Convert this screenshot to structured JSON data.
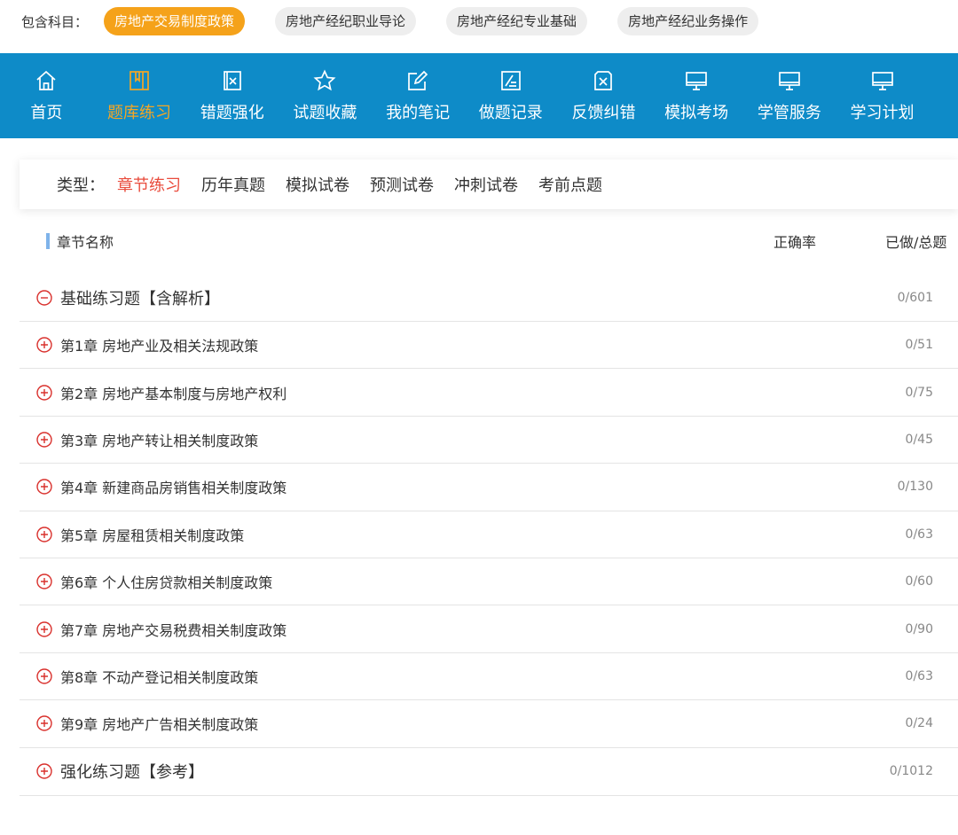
{
  "subjects": {
    "label": "包含科目：",
    "items": [
      {
        "label": "房地产交易制度政策",
        "active": true
      },
      {
        "label": "房地产经纪职业导论",
        "active": false
      },
      {
        "label": "房地产经纪专业基础",
        "active": false
      },
      {
        "label": "房地产经纪业务操作",
        "active": false
      }
    ]
  },
  "nav": {
    "items": [
      {
        "label": "首页",
        "icon": "home-icon"
      },
      {
        "label": "题库练习",
        "icon": "book-icon",
        "active": true
      },
      {
        "label": "错题强化",
        "icon": "wrong-doc-icon"
      },
      {
        "label": "试题收藏",
        "icon": "star-icon"
      },
      {
        "label": "我的笔记",
        "icon": "edit-icon"
      },
      {
        "label": "做题记录",
        "icon": "record-icon"
      },
      {
        "label": "反馈纠错",
        "icon": "feedback-icon"
      },
      {
        "label": "模拟考场",
        "icon": "monitor-icon"
      },
      {
        "label": "学管服务",
        "icon": "monitor-icon"
      },
      {
        "label": "学习计划",
        "icon": "monitor-icon"
      }
    ],
    "active_color": "#f5a623",
    "background": "#0e8bc8"
  },
  "types": {
    "label": "类型：",
    "items": [
      {
        "label": "章节练习",
        "active": true
      },
      {
        "label": "历年真题"
      },
      {
        "label": "模拟试卷"
      },
      {
        "label": "预测试卷"
      },
      {
        "label": "冲刺试卷"
      },
      {
        "label": "考前点题"
      }
    ]
  },
  "table": {
    "headers": {
      "name": "章节名称",
      "accuracy": "正确率",
      "done_total": "已做/总题"
    },
    "rows": [
      {
        "title": "基础练习题【含解析】",
        "count": "0/601",
        "expanded": true,
        "group": true
      },
      {
        "title": "第1章 房地产业及相关法规政策",
        "count": "0/51"
      },
      {
        "title": "第2章 房地产基本制度与房地产权利",
        "count": "0/75"
      },
      {
        "title": "第3章 房地产转让相关制度政策",
        "count": "0/45"
      },
      {
        "title": "第4章 新建商品房销售相关制度政策",
        "count": "0/130"
      },
      {
        "title": "第5章 房屋租赁相关制度政策",
        "count": "0/63"
      },
      {
        "title": "第6章 个人住房贷款相关制度政策",
        "count": "0/60"
      },
      {
        "title": "第7章 房地产交易税费相关制度政策",
        "count": "0/90"
      },
      {
        "title": "第8章 不动产登记相关制度政策",
        "count": "0/63"
      },
      {
        "title": "第9章 房地产广告相关制度政策",
        "count": "0/24"
      },
      {
        "title": "强化练习题【参考】",
        "count": "0/1012",
        "group": true
      }
    ],
    "icon_color": "#d9302c"
  }
}
